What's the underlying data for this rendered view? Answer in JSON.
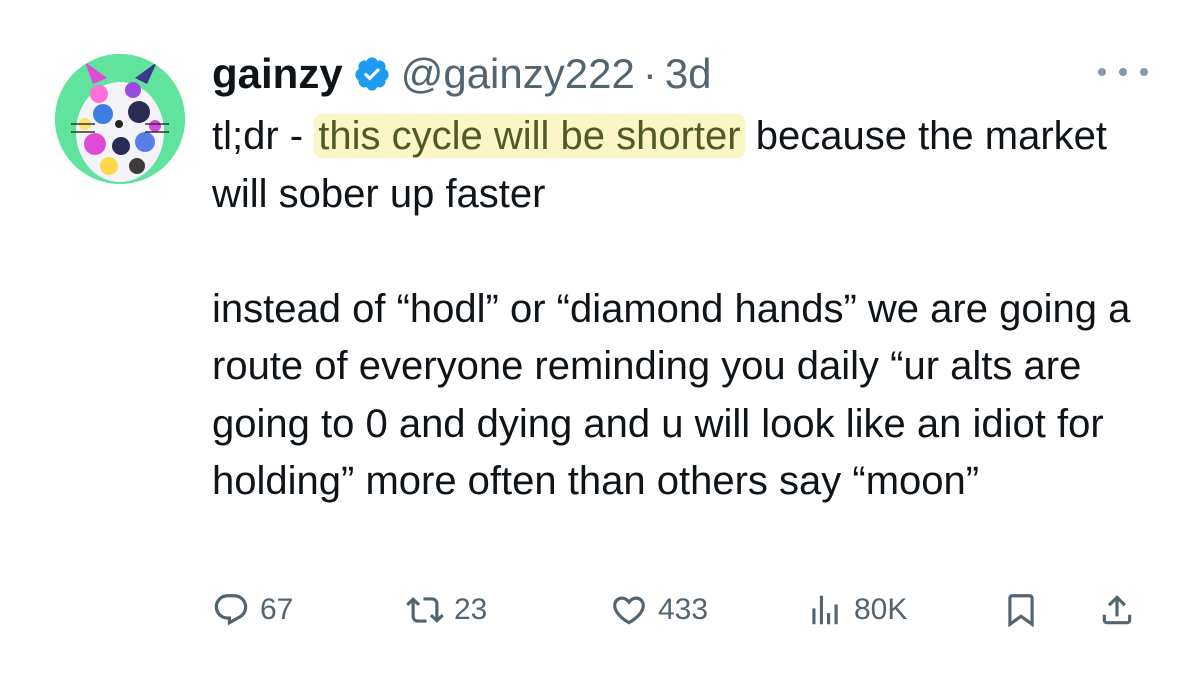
{
  "author": {
    "name": "gainzy",
    "handle": "@gainzy222",
    "separator": "·",
    "time": "3d",
    "verified_color": "#1d9bf0",
    "avatar": "cat-avatar"
  },
  "tweet": {
    "prefix": "tl;dr - ",
    "highlight": "this cycle will be shorter",
    "after_highlight": " because the market will sober up faster",
    "paragraph2": "instead of “hodl” or “diamond hands” we are going a route of everyone reminding you daily “ur alts are going to 0 and dying and u will look like an idiot for holding” more often than others say “moon”",
    "highlight_color": "#fbf6c5"
  },
  "actions": {
    "replies": "67",
    "reposts": "23",
    "likes": "433",
    "views": "80K"
  }
}
